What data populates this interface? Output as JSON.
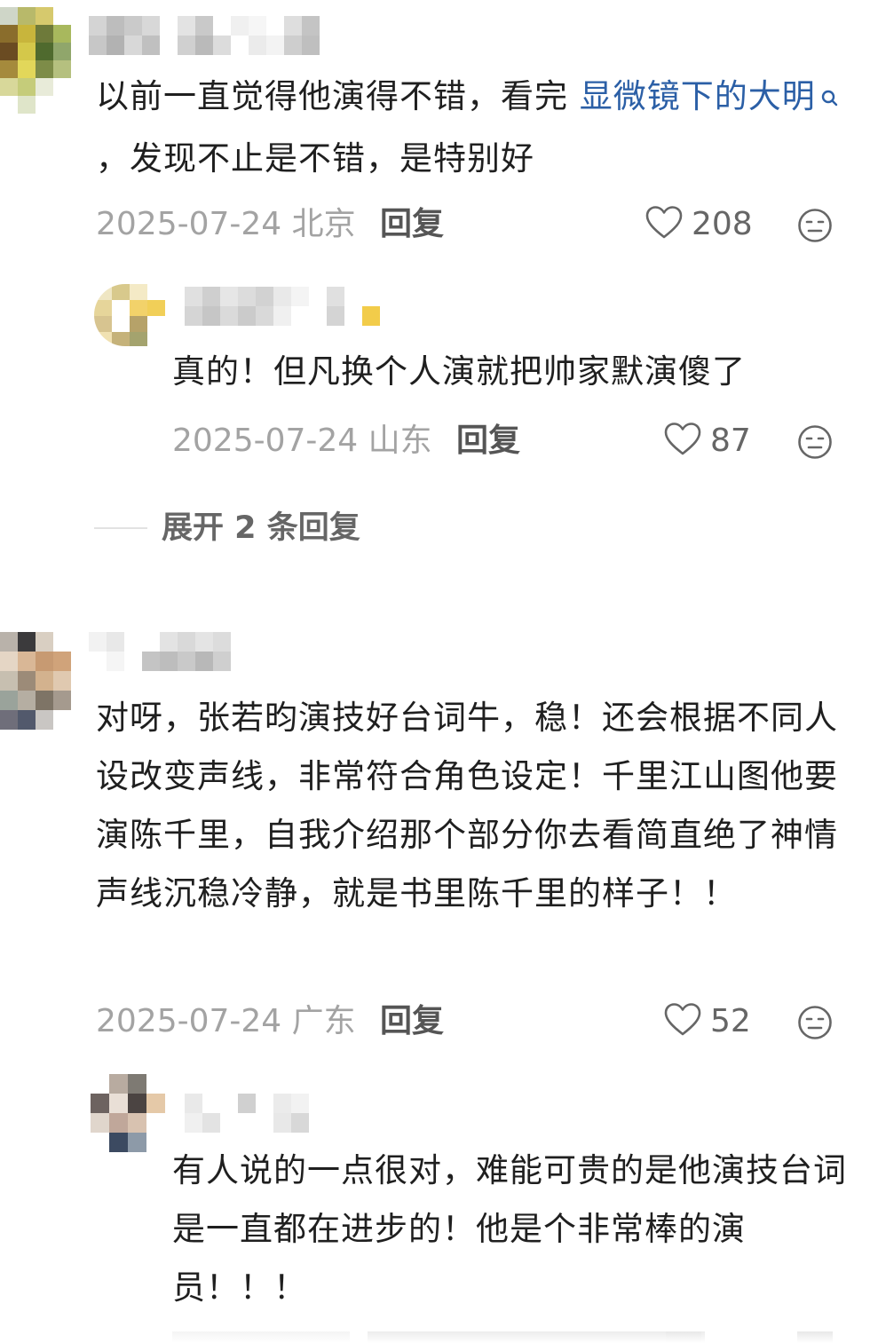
{
  "colors": {
    "text": "#1f1f1f",
    "meta": "#a3a3a3",
    "link": "#2b5fa6",
    "reply": "#555555"
  },
  "comments": [
    {
      "text_before": "以前一直觉得他演得不错，看完 ",
      "link_text": "显微镜下的大明",
      "search_icon": "search-icon",
      "text_after": "，发现不止是不错，是特别好",
      "date": "2025-07-24",
      "location": "北京",
      "reply_label": "回复",
      "likes": "208"
    },
    {
      "text": "真的！但凡换个人演就把帅家默演傻了",
      "date": "2025-07-24",
      "location": "山东",
      "reply_label": "回复",
      "likes": "87"
    },
    {
      "expand_label": "展开 2 条回复"
    },
    {
      "text": "对呀，张若昀演技好台词牛，稳！还会根据不同人设改变声线，非常符合角色设定！千里江山图他要演陈千里，自我介绍那个部分你去看简直绝了神情声线沉稳冷静，就是书里陈千里的样子！！",
      "date": "2025-07-24",
      "location": "广东",
      "reply_label": "回复",
      "likes": "52"
    },
    {
      "text": "有人说的一点很对，难能可贵的是他演技台词是一直都在进步的！他是个非常棒的演员！！！"
    }
  ],
  "icons": {
    "like": "heart-outline-icon",
    "dislike": "neutral-face-icon"
  }
}
